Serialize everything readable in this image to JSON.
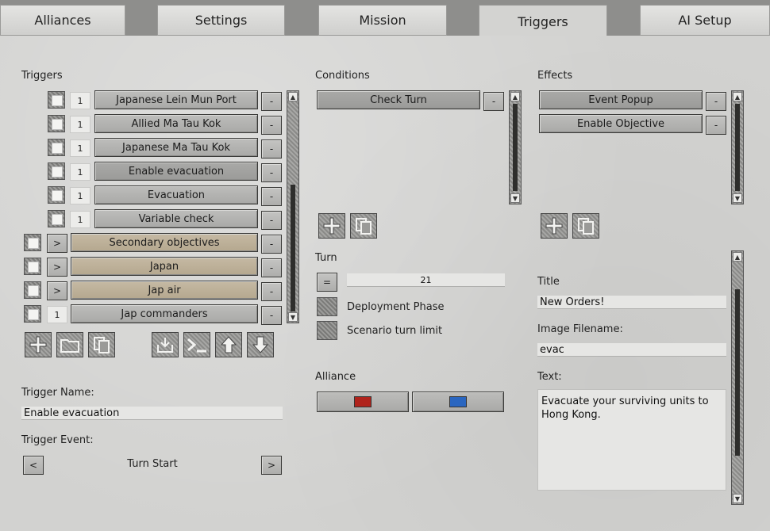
{
  "tabs": [
    {
      "label": "Alliances"
    },
    {
      "label": "Settings"
    },
    {
      "label": "Mission"
    },
    {
      "label": "Triggers"
    },
    {
      "label": "AI Setup"
    }
  ],
  "active_tab": "Triggers",
  "triggers": {
    "header": "Triggers",
    "items": [
      {
        "count": "1",
        "label": "Japanese Lein Mun Port",
        "remove": "-"
      },
      {
        "count": "1",
        "label": "Allied Ma Tau Kok",
        "remove": "-"
      },
      {
        "count": "1",
        "label": "Japanese Ma Tau Kok",
        "remove": "-"
      },
      {
        "count": "1",
        "label": "Enable evacuation",
        "remove": "-",
        "selected": true
      },
      {
        "count": "1",
        "label": "Evacuation",
        "remove": "-"
      },
      {
        "count": "1",
        "label": "Variable check",
        "remove": "-"
      },
      {
        "expand": ">",
        "label": "Secondary objectives",
        "remove": "-",
        "folder": true
      },
      {
        "expand": ">",
        "label": "Japan",
        "remove": "-",
        "folder": true
      },
      {
        "expand": ">",
        "label": "Jap air",
        "remove": "-",
        "folder": true
      },
      {
        "count": "1",
        "label": "Jap commanders",
        "remove": "-"
      }
    ],
    "toolbar_icons": [
      "add-icon",
      "folder-icon",
      "copy-icon",
      "import-icon",
      "console-icon",
      "move-up-icon",
      "move-down-icon"
    ],
    "name_label": "Trigger Name:",
    "name_value": "Enable evacuation",
    "event_label": "Trigger Event:",
    "event_prev": "<",
    "event_value": "Turn Start",
    "event_next": ">"
  },
  "conditions": {
    "header": "Conditions",
    "items": [
      {
        "label": "Check Turn",
        "remove": "-"
      }
    ],
    "toolbar_icons": [
      "add-icon",
      "copy-icon"
    ],
    "turn_label": "Turn",
    "turn_operator": "=",
    "turn_value": "21",
    "deployment_phase": "Deployment Phase",
    "scenario_turn_limit": "Scenario turn limit",
    "alliance_label": "Alliance",
    "alliance_colors": [
      "#b0231c",
      "#2a66c0"
    ]
  },
  "effects": {
    "header": "Effects",
    "items": [
      {
        "label": "Event Popup",
        "remove": "-"
      },
      {
        "label": "Enable Objective",
        "remove": "-"
      }
    ],
    "toolbar_icons": [
      "add-icon",
      "copy-icon"
    ],
    "title_label": "Title",
    "title_value": "New Orders!",
    "image_label": "Image Filename:",
    "image_value": "evac",
    "text_label": "Text:",
    "text_value": "Evacuate your surviving units to Hong Kong."
  }
}
